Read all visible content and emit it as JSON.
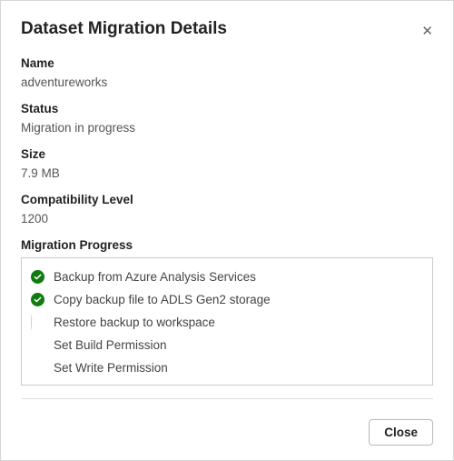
{
  "dialog": {
    "title": "Dataset Migration Details",
    "close_button": "Close"
  },
  "fields": {
    "name": {
      "label": "Name",
      "value": "adventureworks"
    },
    "status": {
      "label": "Status",
      "value": "Migration in progress"
    },
    "size": {
      "label": "Size",
      "value": "7.9 MB"
    },
    "compat": {
      "label": "Compatibility Level",
      "value": "1200"
    }
  },
  "progress": {
    "label": "Migration Progress",
    "steps": [
      {
        "label": "Backup from Azure Analysis Services",
        "state": "done"
      },
      {
        "label": "Copy backup file to ADLS Gen2 storage",
        "state": "done"
      },
      {
        "label": "Restore backup to workspace",
        "state": "running"
      },
      {
        "label": "Set Build Permission",
        "state": "pending"
      },
      {
        "label": "Set Write Permission",
        "state": "pending"
      }
    ]
  }
}
